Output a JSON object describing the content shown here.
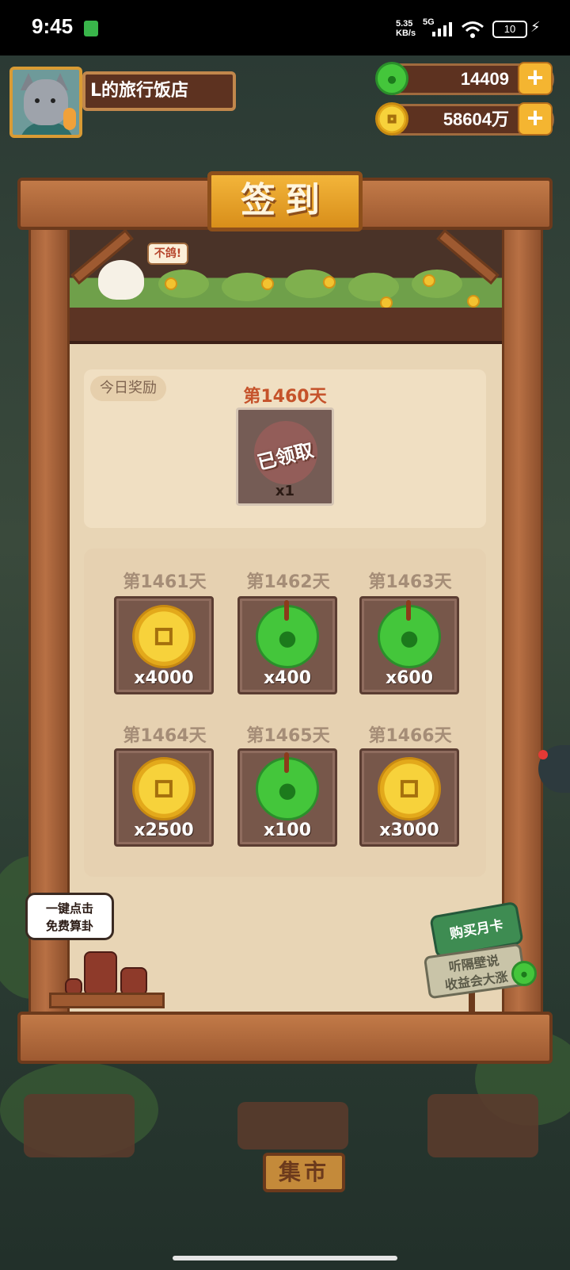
{
  "status_bar": {
    "time": "9:45",
    "net_speed_top": "5.35",
    "net_speed_bottom": "KB/s",
    "network": "5G",
    "battery": "10"
  },
  "player": {
    "shop_name": "L的旅行饭店"
  },
  "currency": {
    "jade": "14409",
    "gold": "58604万",
    "plus": "+"
  },
  "signin": {
    "title": "签到",
    "chick_bubble": "不鸽!",
    "today": {
      "label": "今日奖励",
      "day": "第1460天",
      "status": "已领取",
      "qty": "x1"
    },
    "upcoming": [
      {
        "day": "第1461天",
        "reward": "gold",
        "qty": "x4000"
      },
      {
        "day": "第1462天",
        "reward": "jade",
        "qty": "x400"
      },
      {
        "day": "第1463天",
        "reward": "jade",
        "qty": "x600"
      },
      {
        "day": "第1464天",
        "reward": "gold",
        "qty": "x2500"
      },
      {
        "day": "第1465天",
        "reward": "jade",
        "qty": "x100"
      },
      {
        "day": "第1466天",
        "reward": "gold",
        "qty": "x3000"
      }
    ]
  },
  "fortune": {
    "line1": "一键点击",
    "line2": "免费算卦"
  },
  "monthly_card": {
    "title": "购买月卡",
    "line1": "听隔壁说",
    "line2": "收益会大涨"
  },
  "market": {
    "label": "集市"
  },
  "colors": {
    "wood": "#9e5a31",
    "gold_plate": "#f3b53a",
    "day_today": "#c5522a",
    "jade": "#44c63b",
    "gold": "#f7d23b"
  }
}
